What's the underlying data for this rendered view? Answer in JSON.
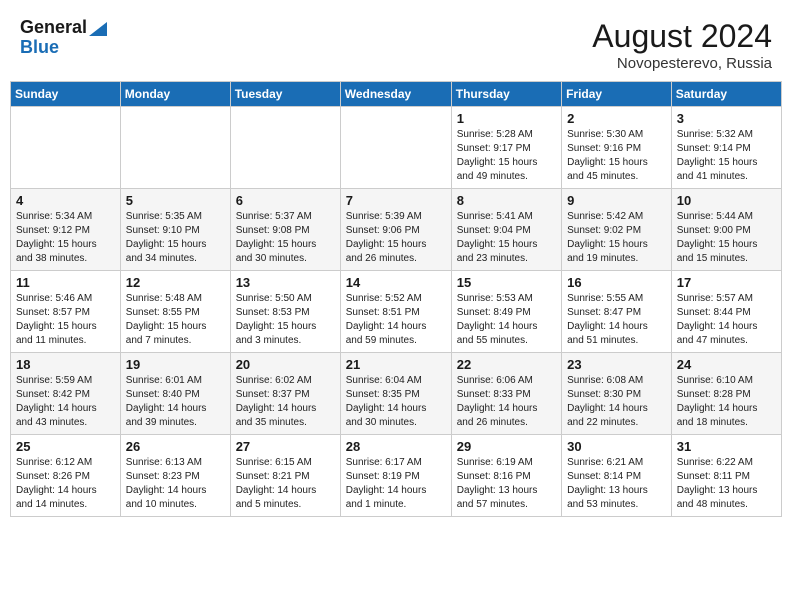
{
  "header": {
    "logo_general": "General",
    "logo_blue": "Blue",
    "month_year": "August 2024",
    "location": "Novopesterevo, Russia"
  },
  "days_of_week": [
    "Sunday",
    "Monday",
    "Tuesday",
    "Wednesday",
    "Thursday",
    "Friday",
    "Saturday"
  ],
  "weeks": [
    [
      {
        "day": "",
        "info": ""
      },
      {
        "day": "",
        "info": ""
      },
      {
        "day": "",
        "info": ""
      },
      {
        "day": "",
        "info": ""
      },
      {
        "day": "1",
        "info": "Sunrise: 5:28 AM\nSunset: 9:17 PM\nDaylight: 15 hours\nand 49 minutes."
      },
      {
        "day": "2",
        "info": "Sunrise: 5:30 AM\nSunset: 9:16 PM\nDaylight: 15 hours\nand 45 minutes."
      },
      {
        "day": "3",
        "info": "Sunrise: 5:32 AM\nSunset: 9:14 PM\nDaylight: 15 hours\nand 41 minutes."
      }
    ],
    [
      {
        "day": "4",
        "info": "Sunrise: 5:34 AM\nSunset: 9:12 PM\nDaylight: 15 hours\nand 38 minutes."
      },
      {
        "day": "5",
        "info": "Sunrise: 5:35 AM\nSunset: 9:10 PM\nDaylight: 15 hours\nand 34 minutes."
      },
      {
        "day": "6",
        "info": "Sunrise: 5:37 AM\nSunset: 9:08 PM\nDaylight: 15 hours\nand 30 minutes."
      },
      {
        "day": "7",
        "info": "Sunrise: 5:39 AM\nSunset: 9:06 PM\nDaylight: 15 hours\nand 26 minutes."
      },
      {
        "day": "8",
        "info": "Sunrise: 5:41 AM\nSunset: 9:04 PM\nDaylight: 15 hours\nand 23 minutes."
      },
      {
        "day": "9",
        "info": "Sunrise: 5:42 AM\nSunset: 9:02 PM\nDaylight: 15 hours\nand 19 minutes."
      },
      {
        "day": "10",
        "info": "Sunrise: 5:44 AM\nSunset: 9:00 PM\nDaylight: 15 hours\nand 15 minutes."
      }
    ],
    [
      {
        "day": "11",
        "info": "Sunrise: 5:46 AM\nSunset: 8:57 PM\nDaylight: 15 hours\nand 11 minutes."
      },
      {
        "day": "12",
        "info": "Sunrise: 5:48 AM\nSunset: 8:55 PM\nDaylight: 15 hours\nand 7 minutes."
      },
      {
        "day": "13",
        "info": "Sunrise: 5:50 AM\nSunset: 8:53 PM\nDaylight: 15 hours\nand 3 minutes."
      },
      {
        "day": "14",
        "info": "Sunrise: 5:52 AM\nSunset: 8:51 PM\nDaylight: 14 hours\nand 59 minutes."
      },
      {
        "day": "15",
        "info": "Sunrise: 5:53 AM\nSunset: 8:49 PM\nDaylight: 14 hours\nand 55 minutes."
      },
      {
        "day": "16",
        "info": "Sunrise: 5:55 AM\nSunset: 8:47 PM\nDaylight: 14 hours\nand 51 minutes."
      },
      {
        "day": "17",
        "info": "Sunrise: 5:57 AM\nSunset: 8:44 PM\nDaylight: 14 hours\nand 47 minutes."
      }
    ],
    [
      {
        "day": "18",
        "info": "Sunrise: 5:59 AM\nSunset: 8:42 PM\nDaylight: 14 hours\nand 43 minutes."
      },
      {
        "day": "19",
        "info": "Sunrise: 6:01 AM\nSunset: 8:40 PM\nDaylight: 14 hours\nand 39 minutes."
      },
      {
        "day": "20",
        "info": "Sunrise: 6:02 AM\nSunset: 8:37 PM\nDaylight: 14 hours\nand 35 minutes."
      },
      {
        "day": "21",
        "info": "Sunrise: 6:04 AM\nSunset: 8:35 PM\nDaylight: 14 hours\nand 30 minutes."
      },
      {
        "day": "22",
        "info": "Sunrise: 6:06 AM\nSunset: 8:33 PM\nDaylight: 14 hours\nand 26 minutes."
      },
      {
        "day": "23",
        "info": "Sunrise: 6:08 AM\nSunset: 8:30 PM\nDaylight: 14 hours\nand 22 minutes."
      },
      {
        "day": "24",
        "info": "Sunrise: 6:10 AM\nSunset: 8:28 PM\nDaylight: 14 hours\nand 18 minutes."
      }
    ],
    [
      {
        "day": "25",
        "info": "Sunrise: 6:12 AM\nSunset: 8:26 PM\nDaylight: 14 hours\nand 14 minutes."
      },
      {
        "day": "26",
        "info": "Sunrise: 6:13 AM\nSunset: 8:23 PM\nDaylight: 14 hours\nand 10 minutes."
      },
      {
        "day": "27",
        "info": "Sunrise: 6:15 AM\nSunset: 8:21 PM\nDaylight: 14 hours\nand 5 minutes."
      },
      {
        "day": "28",
        "info": "Sunrise: 6:17 AM\nSunset: 8:19 PM\nDaylight: 14 hours\nand 1 minute."
      },
      {
        "day": "29",
        "info": "Sunrise: 6:19 AM\nSunset: 8:16 PM\nDaylight: 13 hours\nand 57 minutes."
      },
      {
        "day": "30",
        "info": "Sunrise: 6:21 AM\nSunset: 8:14 PM\nDaylight: 13 hours\nand 53 minutes."
      },
      {
        "day": "31",
        "info": "Sunrise: 6:22 AM\nSunset: 8:11 PM\nDaylight: 13 hours\nand 48 minutes."
      }
    ]
  ]
}
